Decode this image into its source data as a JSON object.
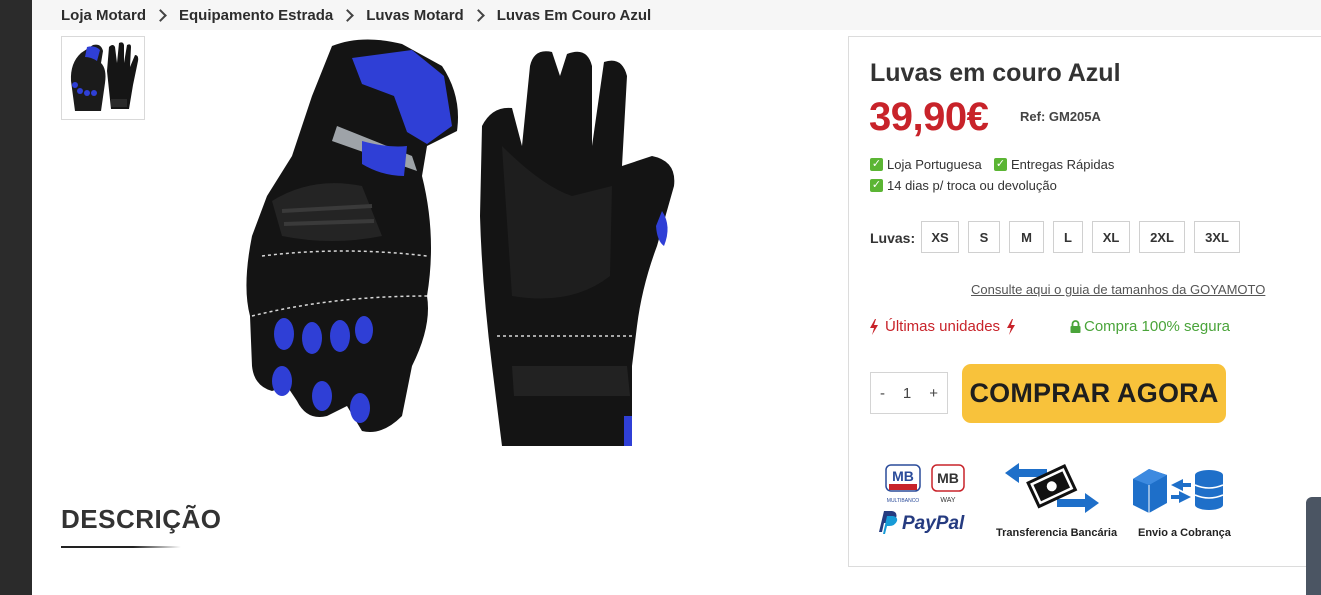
{
  "breadcrumb": {
    "items": [
      {
        "label": "Loja Motard"
      },
      {
        "label": "Equipamento Estrada"
      },
      {
        "label": "Luvas Motard"
      },
      {
        "label": "Luvas Em Couro Azul"
      }
    ]
  },
  "gallery": {
    "thumbnail_icon": "gloves-thumbnail",
    "main_image_icon": "blue-leather-gloves",
    "accent_color": "#2f3fd6"
  },
  "description": {
    "title": "DESCRIÇÃO"
  },
  "product": {
    "title": "Luvas em couro Azul",
    "price": "39,90€",
    "price_color": "#c8232a",
    "ref": "Ref: GM205A",
    "features": [
      "Loja Portuguesa",
      "Entregas Rápidas",
      "14 dias p/ troca ou devolução"
    ],
    "size_label": "Luvas:",
    "sizes": [
      "XS",
      "S",
      "M",
      "L",
      "XL",
      "2XL",
      "3XL"
    ],
    "size_guide_link": "Consulte aqui o guia de tamanhos da GOYAMOTO",
    "stock_notice": "Últimas unidades",
    "secure_notice": "Compra 100% segura",
    "secure_color": "#4aa43a",
    "quantity": {
      "minus": "-",
      "value": "1",
      "plus": "+"
    },
    "buy_button": "COMPRAR AGORA",
    "buy_color": "#f8c23b"
  },
  "payments": {
    "mb_multibanco": {
      "mark": "MB",
      "sub": "MULTIBANCO"
    },
    "mb_way": {
      "mark": "MB",
      "sub": "WAY"
    },
    "paypal": "PayPal",
    "transfer_caption": "Transferencia Bancária",
    "cod_caption": "Envio a Cobrança"
  }
}
